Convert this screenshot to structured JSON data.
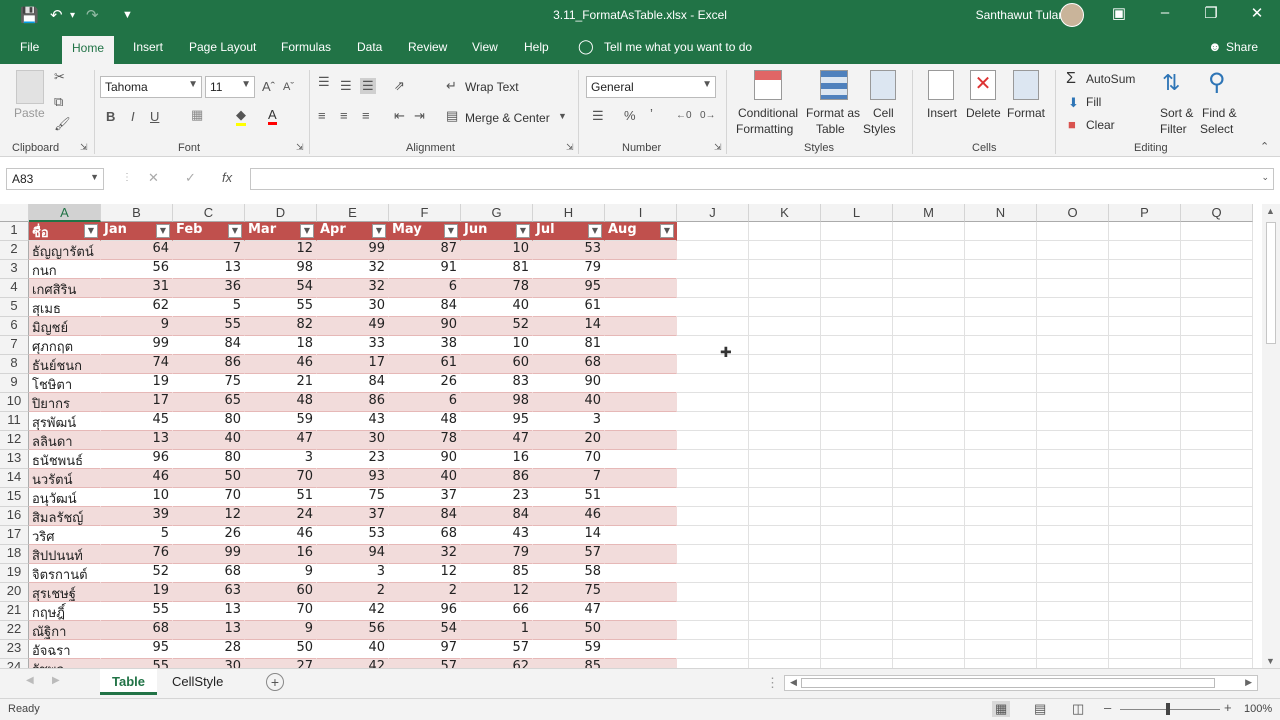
{
  "window": {
    "title": "3.11_FormatAsTable.xlsx  -  Excel",
    "user": "Santhawut Tularak",
    "qat_icons": [
      "save-icon",
      "undo-icon",
      "redo-icon",
      "customize-icon"
    ],
    "controls": [
      "ribbon-display-icon",
      "minimize-icon",
      "restore-icon",
      "close-icon"
    ]
  },
  "menu": {
    "tabs": [
      "File",
      "Home",
      "Insert",
      "Page Layout",
      "Formulas",
      "Data",
      "Review",
      "View",
      "Help"
    ],
    "active": "Home",
    "tell_me": "Tell me what you want to do",
    "share": "Share"
  },
  "ribbon": {
    "clipboard": {
      "paste": "Paste",
      "label": "Clipboard"
    },
    "font": {
      "name": "Tahoma",
      "size": "11",
      "label": "Font"
    },
    "alignment": {
      "wrap": "Wrap Text",
      "merge": "Merge & Center",
      "label": "Alignment"
    },
    "number": {
      "format": "General",
      "label": "Number"
    },
    "styles": {
      "cond1": "Conditional",
      "cond2": "Formatting",
      "fmt1": "Format as",
      "fmt2": "Table",
      "cell1": "Cell",
      "cell2": "Styles",
      "label": "Styles"
    },
    "cells": {
      "insert": "Insert",
      "delete": "Delete",
      "format": "Format",
      "label": "Cells"
    },
    "editing": {
      "autosum": "AutoSum",
      "fill": "Fill",
      "clear": "Clear",
      "sort1": "Sort &",
      "sort2": "Filter",
      "find1": "Find &",
      "find2": "Select",
      "label": "Editing"
    }
  },
  "formula_bar": {
    "name_box": "A83",
    "fx": "fx",
    "value": ""
  },
  "grid": {
    "columns": [
      "A",
      "B",
      "C",
      "D",
      "E",
      "F",
      "G",
      "H",
      "I",
      "J",
      "K",
      "L",
      "M",
      "N",
      "O",
      "P",
      "Q"
    ],
    "selected_column": "A",
    "header_row": [
      "ชื่อ",
      "Jan",
      "Feb",
      "Mar",
      "Apr",
      "May",
      "Jun",
      "Jul",
      "Aug"
    ],
    "rows": [
      [
        "ธัญญารัตน์",
        64,
        7,
        12,
        99,
        87,
        10,
        53
      ],
      [
        "กนก",
        56,
        13,
        98,
        32,
        91,
        81,
        79
      ],
      [
        "เกศสิริน",
        31,
        36,
        54,
        32,
        6,
        78,
        95
      ],
      [
        "สุเมธ",
        62,
        5,
        55,
        30,
        84,
        40,
        61
      ],
      [
        "มิญชย์",
        9,
        55,
        82,
        49,
        90,
        52,
        14
      ],
      [
        "ศุภกฤต",
        99,
        84,
        18,
        33,
        38,
        10,
        81
      ],
      [
        "ธันย์ชนก",
        74,
        86,
        46,
        17,
        61,
        60,
        68
      ],
      [
        "โชษิตา",
        19,
        75,
        21,
        84,
        26,
        83,
        90
      ],
      [
        "ปิยากร",
        17,
        65,
        48,
        86,
        6,
        98,
        40
      ],
      [
        "สุรพัฒน์",
        45,
        80,
        59,
        43,
        48,
        95,
        3
      ],
      [
        "ลลินดา",
        13,
        40,
        47,
        30,
        78,
        47,
        20
      ],
      [
        "ธนัชพนธ์",
        96,
        80,
        3,
        23,
        90,
        16,
        70
      ],
      [
        "นวรัตน์",
        46,
        50,
        70,
        93,
        40,
        86,
        7
      ],
      [
        "อนุวัฒน์",
        10,
        70,
        51,
        75,
        37,
        23,
        51
      ],
      [
        "สิมลรัชญ์",
        39,
        12,
        24,
        37,
        84,
        84,
        46
      ],
      [
        "วริศ",
        5,
        26,
        46,
        53,
        68,
        43,
        14
      ],
      [
        "สิปปนนท์",
        76,
        99,
        16,
        94,
        32,
        79,
        57
      ],
      [
        "จิตรกานต์",
        52,
        68,
        9,
        3,
        12,
        85,
        58
      ],
      [
        "สุรเชษฐ์",
        19,
        63,
        60,
        2,
        2,
        12,
        75
      ],
      [
        "กฤษฎิ์",
        55,
        13,
        70,
        42,
        96,
        66,
        47
      ],
      [
        "ณัฐิกา",
        68,
        13,
        9,
        56,
        54,
        1,
        50
      ],
      [
        "อัจฉรา",
        95,
        28,
        50,
        40,
        97,
        57,
        59
      ],
      [
        "รัชพล",
        55,
        30,
        27,
        42,
        57,
        62,
        85
      ]
    ]
  },
  "sheets": {
    "tabs": [
      "Table",
      "CellStyle"
    ],
    "active": "Table"
  },
  "status": {
    "ready": "Ready",
    "zoom": "100%"
  },
  "colors": {
    "brand": "#217346",
    "table_header": "#c0504d",
    "table_band": "#f2dcdb"
  }
}
